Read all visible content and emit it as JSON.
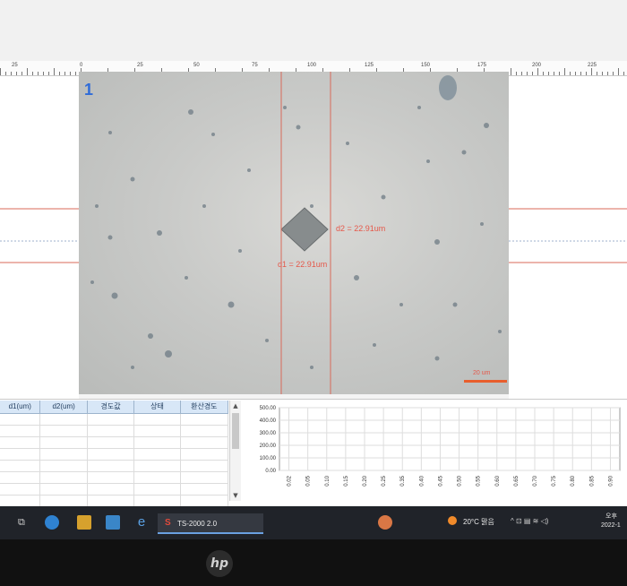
{
  "ruler": {
    "labels": [
      "25",
      "0",
      "25",
      "50",
      "75",
      "100",
      "125",
      "150",
      "175",
      "200",
      "225"
    ]
  },
  "viewer": {
    "image_number": "1",
    "d1_label": "d1 = 22.91um",
    "d2_label": "d2 = 22.91um",
    "scale_bar_label": "20 um"
  },
  "table": {
    "columns": [
      "d1(um)",
      "d2(um)",
      "경도값",
      "상태",
      "환산경도"
    ]
  },
  "chart_data": {
    "type": "line",
    "x_ticks": [
      "0.02",
      "0.05",
      "0.10",
      "0.15",
      "0.20",
      "0.25",
      "0.35",
      "0.40",
      "0.45",
      "0.50",
      "0.55",
      "0.60",
      "0.65",
      "0.70",
      "0.75",
      "0.80",
      "0.85",
      "0.90"
    ],
    "y_ticks": [
      "500.00",
      "400.00",
      "300.00",
      "200.00",
      "100.00",
      "0.00"
    ],
    "ylim": [
      0,
      500
    ],
    "series": []
  },
  "taskbar": {
    "app_label": "TS-2000 2.0",
    "weather": "20°C 맑음",
    "clock_top": "오후",
    "clock_bottom": "2022-1"
  },
  "colors": {
    "measurement_red": "#e5584a",
    "scale_orange": "#e85e2c",
    "taskbar_bg": "#202329"
  }
}
